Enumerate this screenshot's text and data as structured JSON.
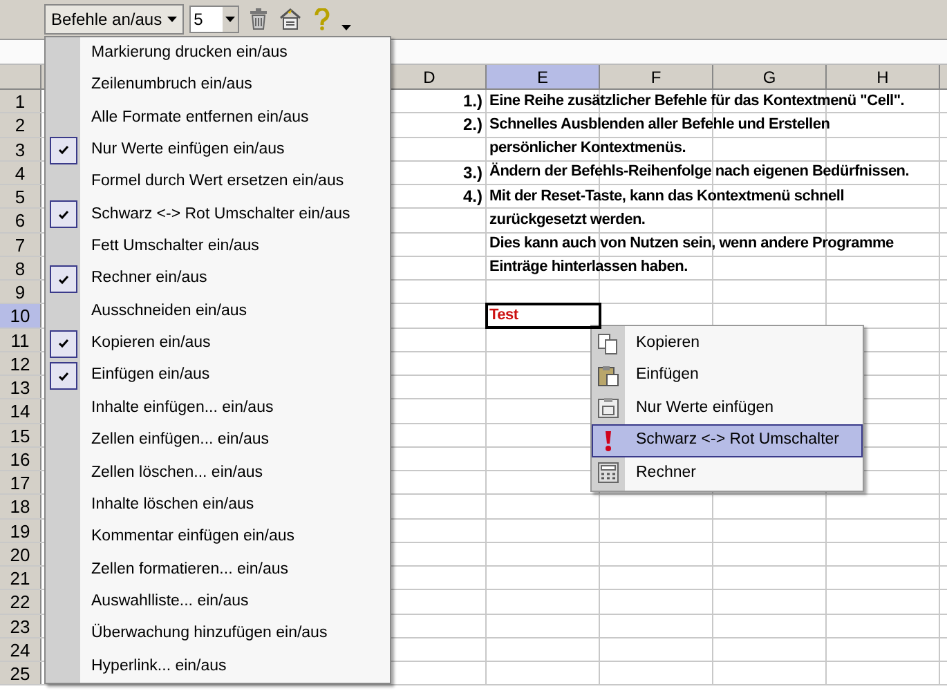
{
  "toolbar": {
    "menu_button": "Befehle an/aus",
    "count_field": "5"
  },
  "columns": [
    {
      "label": "D",
      "selected": false
    },
    {
      "label": "E",
      "selected": true
    },
    {
      "label": "F",
      "selected": false
    },
    {
      "label": "G",
      "selected": false
    },
    {
      "label": "H",
      "selected": false
    }
  ],
  "rows": [
    {
      "label": "1",
      "selected": false,
      "marker": "1.)",
      "text": "Eine Reihe zusätzlicher Befehle für das Kontextmenü \"Cell\".",
      "active": false
    },
    {
      "label": "2",
      "selected": false,
      "marker": "2.)",
      "text": "Schnelles Ausblenden aller Befehle und Erstellen",
      "active": false
    },
    {
      "label": "3",
      "selected": false,
      "text": "persönlicher Kontextmenüs.",
      "active": false
    },
    {
      "label": "4",
      "selected": false,
      "marker": "3.)",
      "text": "Ändern der Befehls-Reihenfolge nach eigenen Bedürfnissen.",
      "active": false
    },
    {
      "label": "5",
      "selected": false,
      "marker": "4.)",
      "text": "Mit der Reset-Taste, kann das Kontextmenü schnell",
      "active": false
    },
    {
      "label": "6",
      "selected": false,
      "text": "zurückgesetzt werden.",
      "active": false
    },
    {
      "label": "7",
      "selected": false,
      "text": "Dies kann auch von Nutzen sein, wenn andere Programme",
      "active": false
    },
    {
      "label": "8",
      "selected": false,
      "text": "Einträge hinterlassen haben.",
      "active": false
    },
    {
      "label": "9",
      "selected": false,
      "active": false
    },
    {
      "label": "10",
      "selected": true,
      "text": "Test",
      "active": true
    },
    {
      "label": "11",
      "selected": false,
      "active": false
    },
    {
      "label": "12",
      "selected": false,
      "active": false
    },
    {
      "label": "13",
      "selected": false,
      "active": false
    },
    {
      "label": "14",
      "selected": false,
      "active": false
    },
    {
      "label": "15",
      "selected": false,
      "active": false
    },
    {
      "label": "16",
      "selected": false,
      "active": false
    },
    {
      "label": "17",
      "selected": false,
      "active": false
    },
    {
      "label": "18",
      "selected": false,
      "active": false
    },
    {
      "label": "19",
      "selected": false,
      "active": false
    },
    {
      "label": "20",
      "selected": false,
      "active": false
    },
    {
      "label": "21",
      "selected": false,
      "active": false
    },
    {
      "label": "22",
      "selected": false,
      "active": false
    },
    {
      "label": "23",
      "selected": false,
      "active": false
    },
    {
      "label": "24",
      "selected": false,
      "active": false
    },
    {
      "label": "25",
      "selected": false,
      "active": false
    }
  ],
  "dropdown_menu": [
    {
      "label": "Markierung drucken ein/aus",
      "checked": false
    },
    {
      "label": "Zeilenumbruch ein/aus",
      "checked": false
    },
    {
      "label": "Alle Formate entfernen ein/aus",
      "checked": false
    },
    {
      "label": "Nur Werte einfügen ein/aus",
      "checked": true
    },
    {
      "label": "Formel durch Wert ersetzen ein/aus",
      "checked": false
    },
    {
      "label": "Schwarz <-> Rot Umschalter ein/aus",
      "checked": true
    },
    {
      "label": "Fett Umschalter ein/aus",
      "checked": false
    },
    {
      "label": "Rechner ein/aus",
      "checked": true
    },
    {
      "label": "Ausschneiden ein/aus",
      "checked": false
    },
    {
      "label": "Kopieren ein/aus",
      "checked": true
    },
    {
      "label": "Einfügen ein/aus",
      "checked": true
    },
    {
      "label": "Inhalte einfügen... ein/aus",
      "checked": false
    },
    {
      "label": "Zellen einfügen... ein/aus",
      "checked": false
    },
    {
      "label": "Zellen löschen... ein/aus",
      "checked": false
    },
    {
      "label": "Inhalte löschen ein/aus",
      "checked": false
    },
    {
      "label": "Kommentar einfügen ein/aus",
      "checked": false
    },
    {
      "label": "Zellen formatieren... ein/aus",
      "checked": false
    },
    {
      "label": "Auswahlliste... ein/aus",
      "checked": false
    },
    {
      "label": "Überwachung hinzufügen ein/aus",
      "checked": false
    },
    {
      "label": "Hyperlink... ein/aus",
      "checked": false
    }
  ],
  "context_menu": [
    {
      "kind": "copy",
      "label": "Kopieren",
      "selected": false
    },
    {
      "kind": "paste",
      "label": "Einfügen",
      "selected": false
    },
    {
      "kind": "values",
      "label": "Nur Werte einfügen",
      "selected": false
    },
    {
      "kind": "toggle",
      "label": "Schwarz <-> Rot Umschalter",
      "selected": true
    },
    {
      "kind": "calculator",
      "label": "Rechner",
      "selected": false
    }
  ]
}
